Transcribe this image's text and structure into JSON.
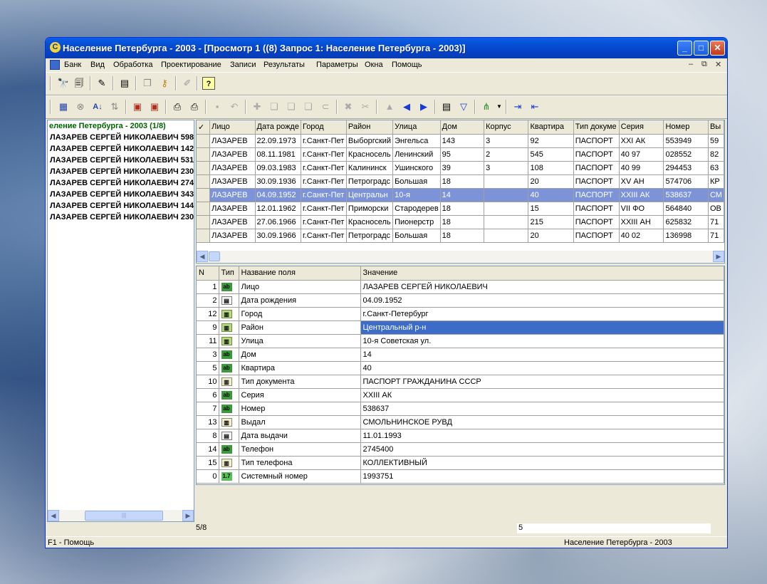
{
  "window": {
    "title": "Население Петербурга - 2003 - [Просмотр 1 ((8) Запрос 1: Население Петербурга - 2003)]",
    "app_icon": "C",
    "min_glyph": "_",
    "max_glyph": "□",
    "close_glyph": "✕"
  },
  "menu": [
    "Банк",
    "Вид",
    "Обработка",
    "Проектирование",
    "Записи",
    "Результаты",
    "Параметры",
    "Окна",
    "Помощь"
  ],
  "mdi_controls": [
    "–",
    "⧉",
    "✕"
  ],
  "toolbar1_icons": [
    "binoculars-icon",
    "binoculars-doc-icon",
    "edit-chart-icon",
    "monitor-icon",
    "copy-icon",
    "key-icon",
    "pencil-icon",
    "help-icon"
  ],
  "toolbar2_icons": [
    "bank-icon",
    "cancel-icon",
    "sort-icon",
    "filter-sort-icon",
    "export-icon",
    "import-icon",
    "print-icon",
    "print-preview-icon",
    "save-icon",
    "undo-icon",
    "new-record-icon",
    "copy-record-icon",
    "duplicate-icon",
    "paste-icon",
    "link-icon",
    "delete-icon",
    "cut-icon",
    "move-up-icon",
    "prev-icon",
    "next-icon",
    "properties-icon",
    "filter-icon",
    "tree-icon",
    "export-right-icon",
    "import-left-icon"
  ],
  "tree": {
    "root": "еление Петербурга - 2003 (1/8)",
    "items": [
      "ЛАЗАРЕВ СЕРГЕЙ НИКОЛАЕВИЧ 598",
      "ЛАЗАРЕВ СЕРГЕЙ НИКОЛАЕВИЧ 142",
      "ЛАЗАРЕВ СЕРГЕЙ НИКОЛАЕВИЧ 531",
      "ЛАЗАРЕВ СЕРГЕЙ НИКОЛАЕВИЧ 230",
      "ЛАЗАРЕВ СЕРГЕЙ НИКОЛАЕВИЧ 274",
      "ЛАЗАРЕВ СЕРГЕЙ НИКОЛАЕВИЧ 343",
      "ЛАЗАРЕВ СЕРГЕЙ НИКОЛАЕВИЧ 144",
      "ЛАЗАРЕВ СЕРГЕЙ НИКОЛАЕВИЧ 230"
    ]
  },
  "grid": {
    "header_mark": "✓",
    "columns": [
      "Лицо",
      "Дата рожде",
      "Город",
      "Район",
      "Улица",
      "Дом",
      "Корпус",
      "Квартира",
      "Тип докуме",
      "Серия",
      "Номер",
      "Вы"
    ],
    "rows": [
      [
        "ЛАЗАРЕВ",
        "22.09.1973",
        "г.Санкт-Пет",
        "Выборгский",
        "Энгельса",
        "143",
        "3",
        "92",
        "ПАСПОРТ",
        "XXI АК",
        "553949",
        "59"
      ],
      [
        "ЛАЗАРЕВ",
        "08.11.1981",
        "г.Санкт-Пет",
        "Красносель",
        "Ленинский",
        "95",
        "2",
        "545",
        "ПАСПОРТ",
        "40 97",
        "028552",
        "82"
      ],
      [
        "ЛАЗАРЕВ",
        "09.03.1983",
        "г.Санкт-Пет",
        "Калининск",
        "Ушинского",
        "39",
        "3",
        "108",
        "ПАСПОРТ",
        "40 99",
        "294453",
        "63"
      ],
      [
        "ЛАЗАРЕВ",
        "30.09.1936",
        "г.Санкт-Пет",
        "Петроградс",
        "Большая",
        "18",
        "",
        "20",
        "ПАСПОРТ",
        "XV АН",
        "574706",
        "КР"
      ],
      [
        "ЛАЗАРЕВ",
        "04.09.1952",
        "г.Санкт-Пет",
        "Центральн",
        "10-я",
        "14",
        "",
        "40",
        "ПАСПОРТ",
        "XXIII АК",
        "538637",
        "СМ"
      ],
      [
        "ЛАЗАРЕВ",
        "12.01.1962",
        "г.Санкт-Пет",
        "Приморски",
        "Стародерев",
        "18",
        "",
        "15",
        "ПАСПОРТ",
        "VII ФО",
        "564840",
        "ОВ"
      ],
      [
        "ЛАЗАРЕВ",
        "27.06.1966",
        "г.Санкт-Пет",
        "Красносель",
        "Пионерстр",
        "18",
        "",
        "215",
        "ПАСПОРТ",
        "XXIII АН",
        "625832",
        "71"
      ],
      [
        "ЛАЗАРЕВ",
        "30.09.1966",
        "г.Санкт-Пет",
        "Петроградс",
        "Большая",
        "18",
        "",
        "20",
        "ПАСПОРТ",
        "40 02",
        "136998",
        "71"
      ]
    ],
    "selected_row": 4
  },
  "props": {
    "columns": [
      "N",
      "Тип",
      "Название поля",
      "Значение"
    ],
    "rows": [
      {
        "n": "1",
        "type": "ab",
        "name": "Лицо",
        "value": "ЛАЗАРЕВ СЕРГЕЙ НИКОЛАЕВИЧ"
      },
      {
        "n": "2",
        "type": "date",
        "name": "Дата рождения",
        "value": "04.09.1952"
      },
      {
        "n": "12",
        "type": "lnk",
        "name": "Город",
        "value": "г.Санкт-Петербург"
      },
      {
        "n": "9",
        "type": "lnk",
        "name": "Район",
        "value": "Центральный р-н"
      },
      {
        "n": "11",
        "type": "lnk",
        "name": "Улица",
        "value": "10-я Советская ул."
      },
      {
        "n": "3",
        "type": "ab",
        "name": "Дом",
        "value": "14"
      },
      {
        "n": "5",
        "type": "ab",
        "name": "Квартира",
        "value": "40"
      },
      {
        "n": "10",
        "type": "ref",
        "name": "Тип документа",
        "value": "ПАСПОРТ ГРАЖДАНИНА СССР"
      },
      {
        "n": "6",
        "type": "ab",
        "name": "Серия",
        "value": "XXIII АК"
      },
      {
        "n": "7",
        "type": "ab",
        "name": "Номер",
        "value": "538637"
      },
      {
        "n": "13",
        "type": "ref",
        "name": "Выдал",
        "value": "СМОЛЬНИНСКОЕ РУВД"
      },
      {
        "n": "8",
        "type": "date",
        "name": "Дата выдачи",
        "value": "11.01.1993"
      },
      {
        "n": "14",
        "type": "ab",
        "name": "Телефон",
        "value": "2745400"
      },
      {
        "n": "15",
        "type": "ref",
        "name": "Тип телефона",
        "value": "КОЛЛЕКТИВНЫЙ"
      },
      {
        "n": "0",
        "type": "int",
        "name": "Системный номер",
        "value": "1993751"
      }
    ],
    "selected_row": 3
  },
  "status": {
    "record_pos": "5/8",
    "record_num": "5",
    "help": "F1 - Помощь",
    "bank": "Население Петербурга - 2003"
  },
  "type_labels": {
    "ab": "ab",
    "date": "▤",
    "lnk": "▥",
    "ref": "▥",
    "int": "1.7"
  },
  "scroll_glyphs": {
    "left": "◀",
    "right": "▶",
    "thumb": "|||"
  }
}
